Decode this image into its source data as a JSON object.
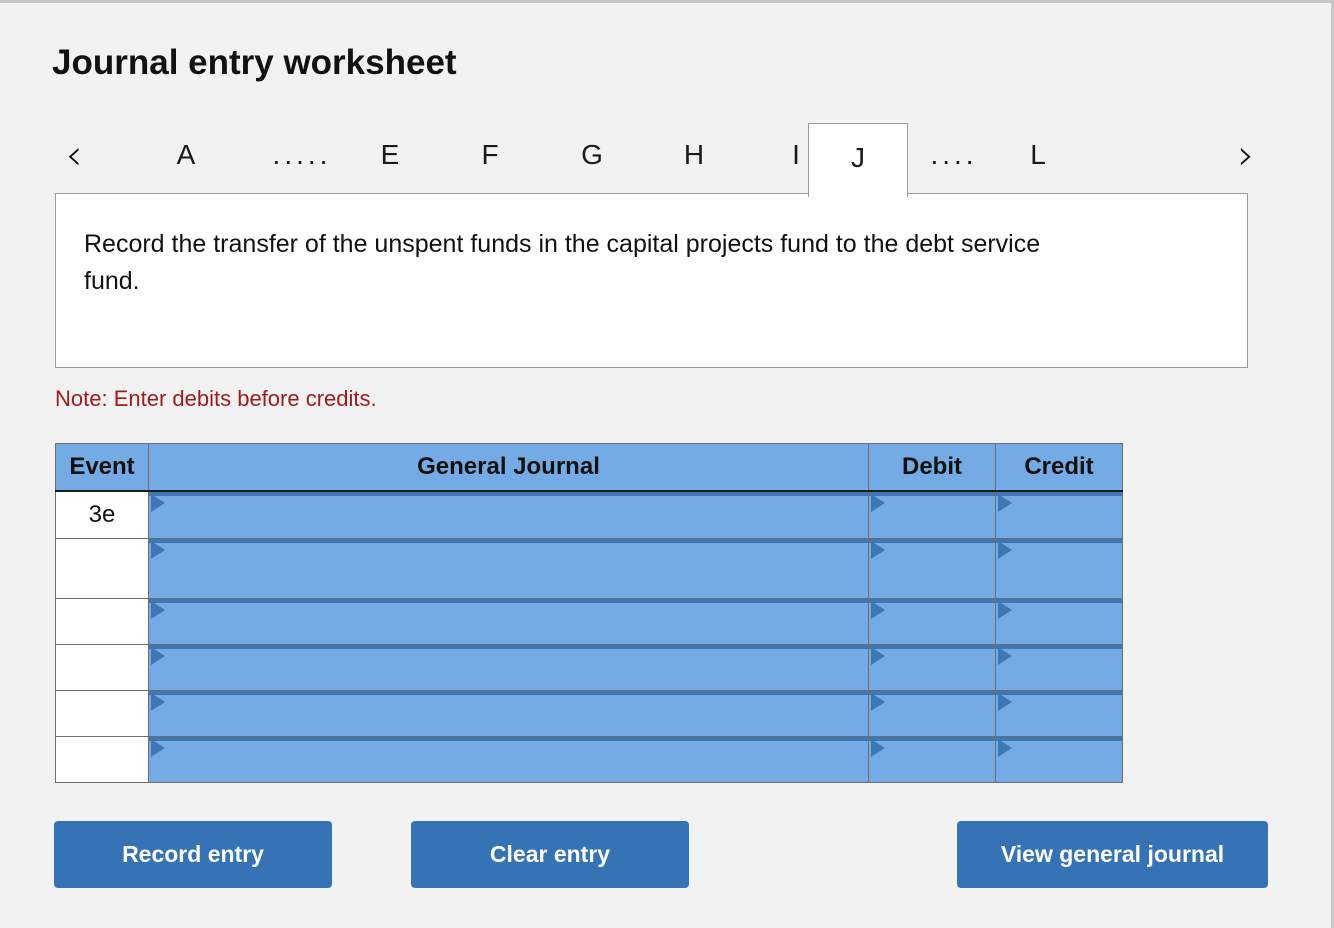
{
  "page": {
    "title": "Journal entry worksheet",
    "background_color": "#f2f2f2"
  },
  "tabs": {
    "prev_icon": "‹",
    "next_icon": "›",
    "items": [
      {
        "label": "A",
        "active": false,
        "type": "letter"
      },
      {
        "label": ".....",
        "active": false,
        "type": "ellipsis"
      },
      {
        "label": "E",
        "active": false,
        "type": "letter"
      },
      {
        "label": "F",
        "active": false,
        "type": "letter"
      },
      {
        "label": "G",
        "active": false,
        "type": "letter"
      },
      {
        "label": "H",
        "active": false,
        "type": "letter"
      },
      {
        "label": "I",
        "active": false,
        "type": "letter"
      },
      {
        "label": "J",
        "active": true,
        "type": "letter"
      },
      {
        "label": "....",
        "active": false,
        "type": "ellipsis"
      },
      {
        "label": "L",
        "active": false,
        "type": "letter"
      }
    ]
  },
  "description": {
    "text": "Record the transfer of the unspent funds in the capital projects fund to the debt service fund."
  },
  "note": {
    "text": "Note: Enter debits before credits.",
    "color": "#9e1b1b"
  },
  "journal_table": {
    "header_color": "#74abe4",
    "cell_border_color": "#3d78b4",
    "columns": [
      "Event",
      "General Journal",
      "Debit",
      "Credit"
    ],
    "rows": [
      {
        "event": "3e",
        "general_journal": "",
        "debit": "",
        "credit": ""
      },
      {
        "event": "",
        "general_journal": "",
        "debit": "",
        "credit": ""
      },
      {
        "event": "",
        "general_journal": "",
        "debit": "",
        "credit": ""
      },
      {
        "event": "",
        "general_journal": "",
        "debit": "",
        "credit": ""
      },
      {
        "event": "",
        "general_journal": "",
        "debit": "",
        "credit": ""
      },
      {
        "event": "",
        "general_journal": "",
        "debit": "",
        "credit": ""
      }
    ]
  },
  "buttons": {
    "record_entry": "Record entry",
    "clear_entry": "Clear entry",
    "view_general_journal": "View general journal",
    "color": "#3573b4"
  }
}
